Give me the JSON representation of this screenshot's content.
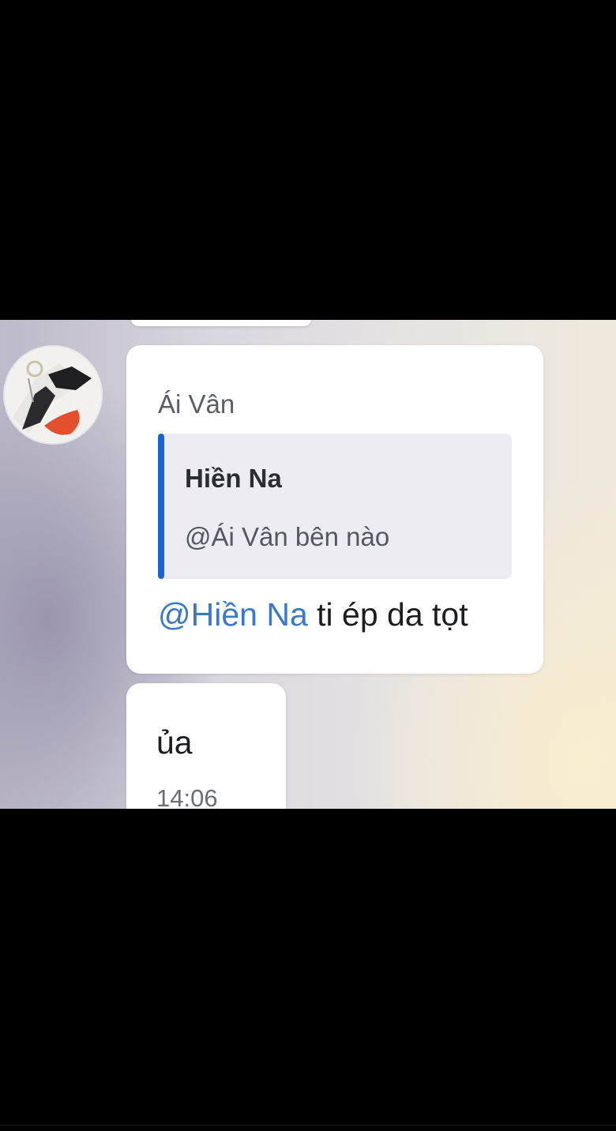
{
  "chat": {
    "message": {
      "sender": "Ái Vân",
      "reply_to": {
        "author": "Hiền Na",
        "text": "@Ái Vân bên nào"
      },
      "mention": "@Hiền Na",
      "text": " ti ép da tọt"
    },
    "next_message": {
      "text": "ủa",
      "time": "14:06"
    },
    "avatar_icon": "profile-photo-icon"
  },
  "colors": {
    "mention": "#3a78c9",
    "quote_bar": "#1a63d6",
    "bubble": "#ffffff",
    "quote_background": "#ececf2"
  }
}
